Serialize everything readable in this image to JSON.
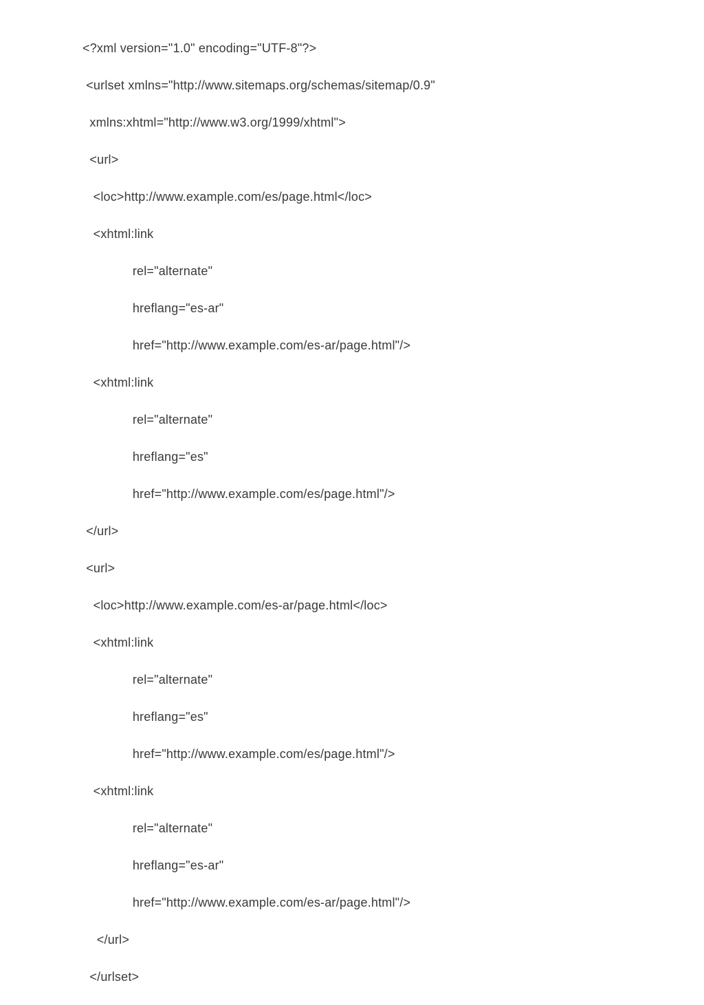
{
  "code": {
    "l1": "<?xml version=\"1.0\" encoding=\"UTF-8\"?>",
    "l2": " <urlset xmlns=\"http://www.sitemaps.org/schemas/sitemap/0.9\"",
    "l3": "  xmlns:xhtml=\"http://www.w3.org/1999/xhtml\">",
    "l4": "  <url>",
    "l5": "   <loc>http://www.example.com/es/page.html</loc>",
    "l6": "   <xhtml:link",
    "l7": "              rel=\"alternate\"",
    "l8": "              hreflang=\"es-ar\"",
    "l9": "              href=\"http://www.example.com/es-ar/page.html\"/>",
    "l10": "   <xhtml:link",
    "l11": "              rel=\"alternate\"",
    "l12": "              hreflang=\"es\"",
    "l13": "              href=\"http://www.example.com/es/page.html\"/>",
    "l14": " </url>",
    "l15": " <url>",
    "l16": "   <loc>http://www.example.com/es-ar/page.html</loc>",
    "l17": "   <xhtml:link",
    "l18": "              rel=\"alternate\"",
    "l19": "              hreflang=\"es\"",
    "l20": "              href=\"http://www.example.com/es/page.html\"/>",
    "l21": "   <xhtml:link",
    "l22": "              rel=\"alternate\"",
    "l23": "              hreflang=\"es-ar\"",
    "l24": "              href=\"http://www.example.com/es-ar/page.html\"/>",
    "l25": "    </url>",
    "l26": "  </urlset>"
  }
}
